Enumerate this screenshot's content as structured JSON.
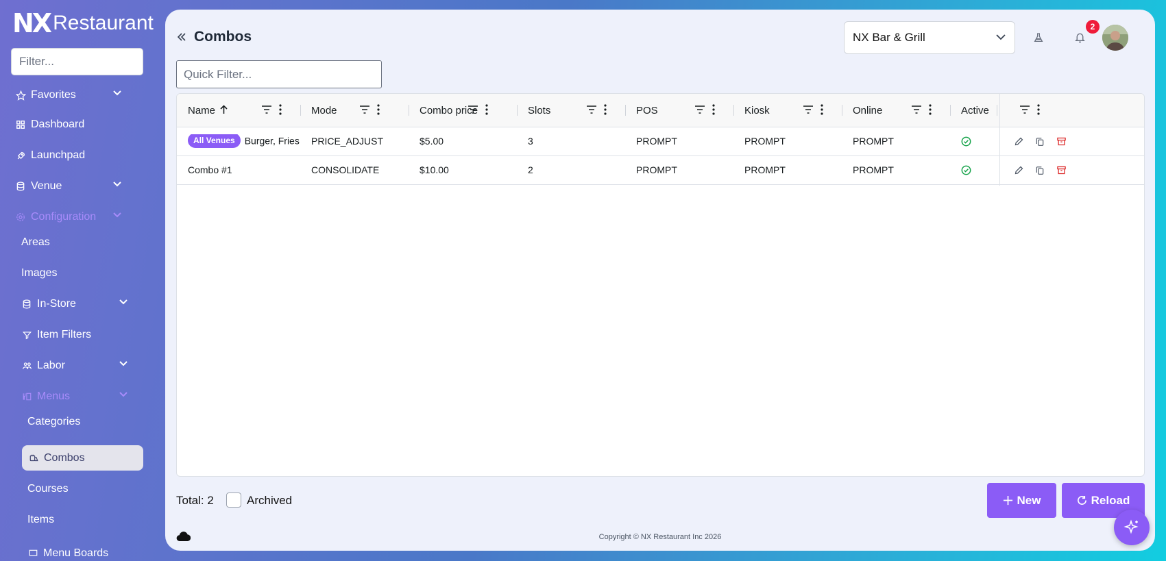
{
  "app": {
    "logo_mark": "NX",
    "logo_name": "Restaurant"
  },
  "sidebar": {
    "filter_placeholder": "Filter...",
    "items": [
      {
        "label": "Favorites",
        "icon": "star-icon",
        "has_chevron": true
      },
      {
        "label": "Dashboard",
        "icon": "dashboard-icon"
      },
      {
        "label": "Launchpad",
        "icon": "rocket-icon"
      },
      {
        "label": "Venue",
        "icon": "database-icon",
        "has_chevron": true
      },
      {
        "label": "Configuration",
        "icon": "gear-icon",
        "has_chevron": true,
        "expanded": true
      },
      {
        "label": "Areas"
      },
      {
        "label": "Images"
      },
      {
        "label": "In-Store",
        "icon": "store-icon",
        "has_chevron": true
      },
      {
        "label": "Item Filters",
        "icon": "filter-tag-icon"
      },
      {
        "label": "Labor",
        "icon": "users-icon",
        "has_chevron": true
      },
      {
        "label": "Menus",
        "icon": "menu-icon",
        "has_chevron": true,
        "expanded": true
      },
      {
        "label": "Categories"
      },
      {
        "label": "Combos",
        "icon": "combo-icon",
        "active": true
      },
      {
        "label": "Courses"
      },
      {
        "label": "Items"
      },
      {
        "label": "Menu Boards",
        "icon": "board-icon"
      }
    ]
  },
  "header": {
    "title": "Combos",
    "venue": "NX Bar & Grill",
    "notification_count": "2"
  },
  "quick_filter": {
    "placeholder": "Quick Filter..."
  },
  "grid": {
    "columns": [
      "Name",
      "Mode",
      "Combo price",
      "Slots",
      "POS",
      "Kiosk",
      "Online",
      "Active"
    ],
    "rows": [
      {
        "badge": "All Venues",
        "name": "Burger, Fries",
        "mode": "PRICE_ADJUST",
        "price": "$5.00",
        "slots": "3",
        "pos": "PROMPT",
        "kiosk": "PROMPT",
        "online": "PROMPT",
        "active": true
      },
      {
        "badge": "",
        "name": "Combo #1",
        "mode": "CONSOLIDATE",
        "price": "$10.00",
        "slots": "2",
        "pos": "PROMPT",
        "kiosk": "PROMPT",
        "online": "PROMPT",
        "active": true
      }
    ]
  },
  "footer": {
    "total": "Total: 2",
    "archived_label": "Archived",
    "new_label": "New",
    "reload_label": "Reload",
    "copyright": "Copyright © NX Restaurant Inc 2026"
  },
  "colors": {
    "accent": "#8b5cf6",
    "danger": "#dc2626",
    "success": "#16a34a"
  }
}
